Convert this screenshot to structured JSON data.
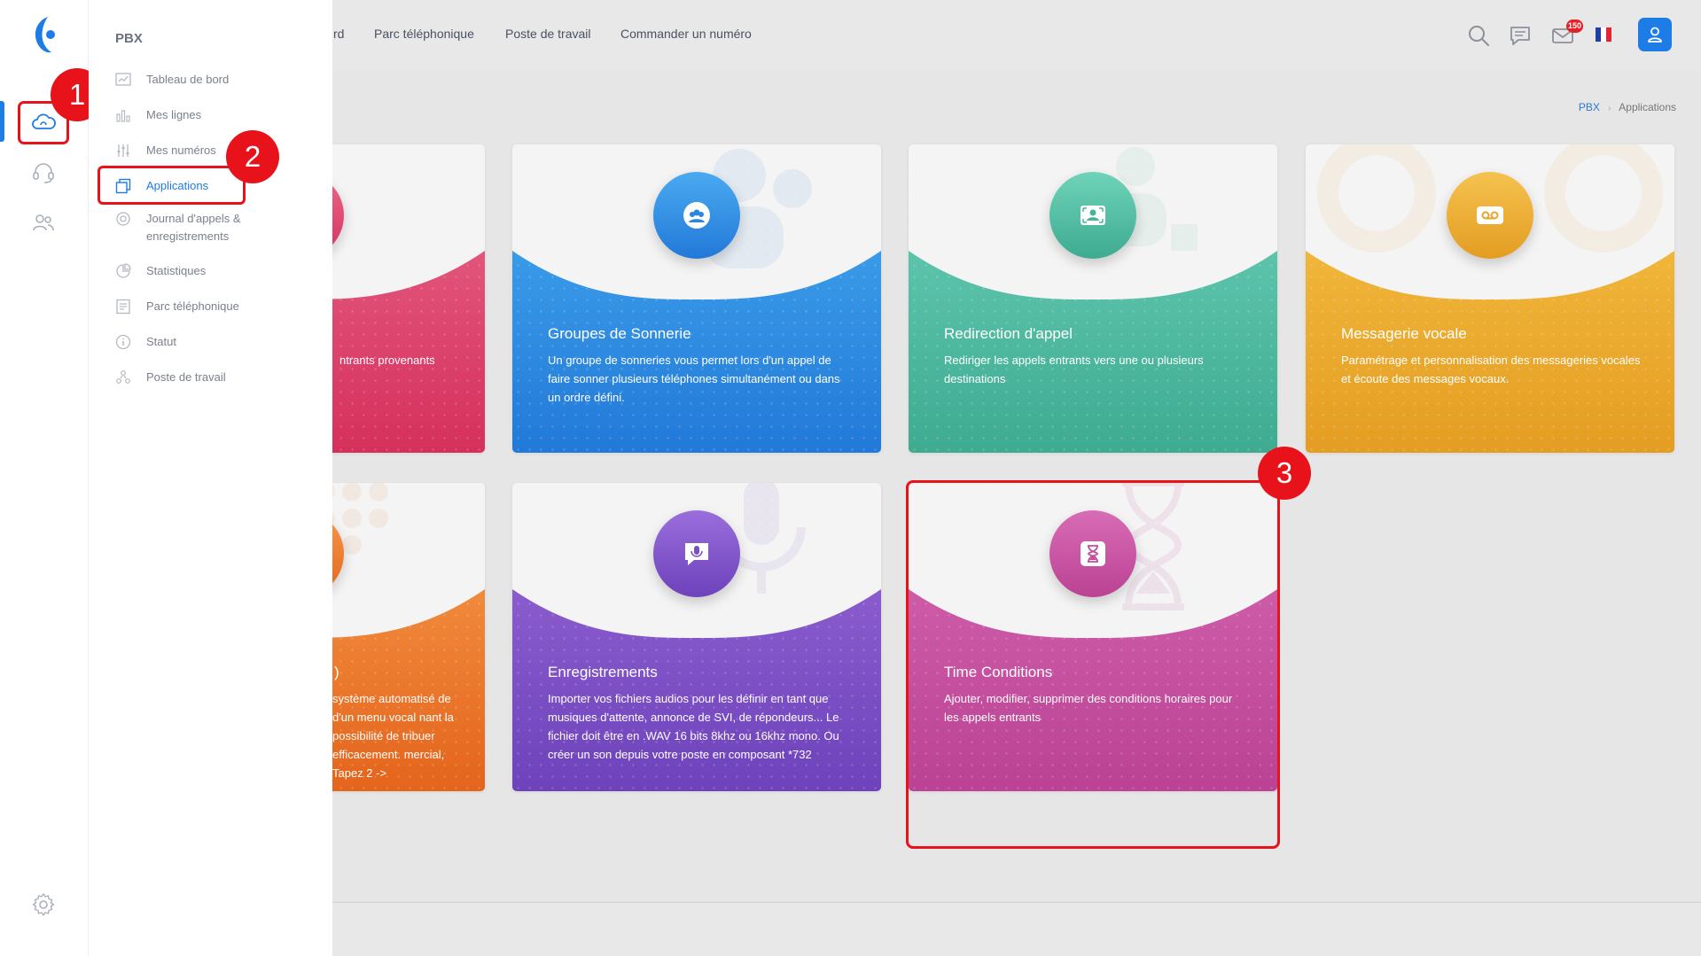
{
  "topnav": [
    {
      "label": "rd"
    },
    {
      "label": "Parc téléphonique"
    },
    {
      "label": "Poste de travail"
    },
    {
      "label": "Commander un numéro"
    }
  ],
  "header": {
    "mail_badge": "150",
    "flag_colors": [
      "#1f3fa5",
      "#ffffff",
      "#e22433"
    ]
  },
  "breadcrumb": {
    "root": "PBX",
    "separator": "›",
    "current": "Applications"
  },
  "sidebar": {
    "section_title": "PBX",
    "items": [
      {
        "label": "Tableau de bord",
        "icon": "chart-icon"
      },
      {
        "label": "Mes lignes",
        "icon": "lines-icon"
      },
      {
        "label": "Mes numéros",
        "icon": "numbers-icon"
      },
      {
        "label": "Applications",
        "icon": "apps-icon",
        "active": true
      },
      {
        "label": "Journal d'appels & enregistrements",
        "icon": "journal-icon"
      },
      {
        "label": "Statistiques",
        "icon": "stats-icon"
      },
      {
        "label": "Parc téléphonique",
        "icon": "phone-park-icon"
      },
      {
        "label": "Statut",
        "icon": "info-icon"
      },
      {
        "label": "Poste de travail",
        "icon": "workstation-icon"
      }
    ]
  },
  "cards": [
    {
      "title": "",
      "desc": "ntrants provenants",
      "color_top": "#e2557b",
      "color_bottom": "#d5305c"
    },
    {
      "title": "Groupes de Sonnerie",
      "desc": "Un groupe de sonneries vous permet lors d'un appel de faire sonner plusieurs téléphones simultanément ou dans un ordre défini.",
      "color_top": "#3a9be8",
      "color_bottom": "#2279d8"
    },
    {
      "title": "Redirection d'appel",
      "desc": "Rediriger les appels entrants vers une ou plusieurs destinations",
      "color_top": "#5dc4ac",
      "color_bottom": "#3eab91"
    },
    {
      "title": "Messagerie vocale",
      "desc": "Paramétrage et personnalisation des messageries vocales et écoute des messages vocaux.",
      "color_top": "#f0b63a",
      "color_bottom": "#e49d22"
    },
    {
      "title": ")",
      "desc": "système automatisé de d'un menu vocal nant la possibilité de tribuer efficacement. mercial, Tapez 2 ->",
      "color_top": "#f08a3c",
      "color_bottom": "#e4641c"
    },
    {
      "title": "Enregistrements",
      "desc": "Importer vos fichiers audios pour les définir en tant que musiques d'attente, annonce de SVI, de répondeurs... Le fichier doit être en .WAV 16 bits 8khz ou 16khz mono. Ou créer un son depuis votre poste en composant *732",
      "color_top": "#8a5ccd",
      "color_bottom": "#6d42bb"
    },
    {
      "title": "Time Conditions",
      "desc": "Ajouter, modifier, supprimer des conditions horaires pour les appels entrants",
      "color_top": "#cd5ca8",
      "color_bottom": "#bb4294"
    }
  ],
  "annotations": {
    "step1": "1",
    "step2": "2",
    "step3": "3"
  }
}
